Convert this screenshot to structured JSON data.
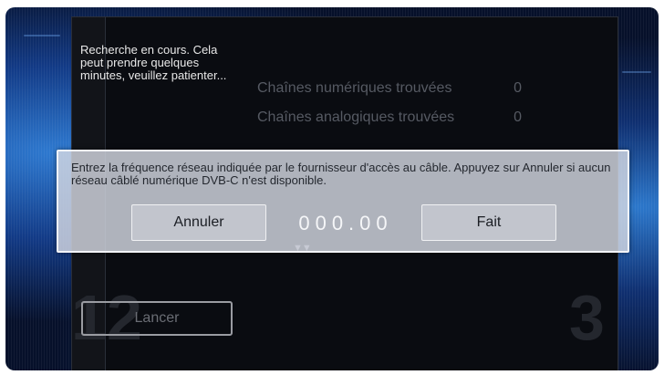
{
  "wizard": {
    "searching_text": "Recherche en cours. Cela peut prendre quelques minutes, veuillez patienter...",
    "results": [
      {
        "label": "Chaînes numériques trouvées",
        "count": "0"
      },
      {
        "label": "Chaînes analogiques trouvées",
        "count": "0"
      }
    ],
    "step_left": "12",
    "step_right": "3",
    "start_button": "Lancer"
  },
  "dialog": {
    "message": "Entrez la fréquence réseau indiquée par le fournisseur d'accès au câble. Appuyez sur Annuler si aucun réseau câblé numérique DVB-C n'est disponible.",
    "cancel_label": "Annuler",
    "frequency_value": "000.00",
    "done_label": "Fait"
  },
  "colors": {
    "background": "#06102a",
    "dialog": "#d4d8e2"
  }
}
